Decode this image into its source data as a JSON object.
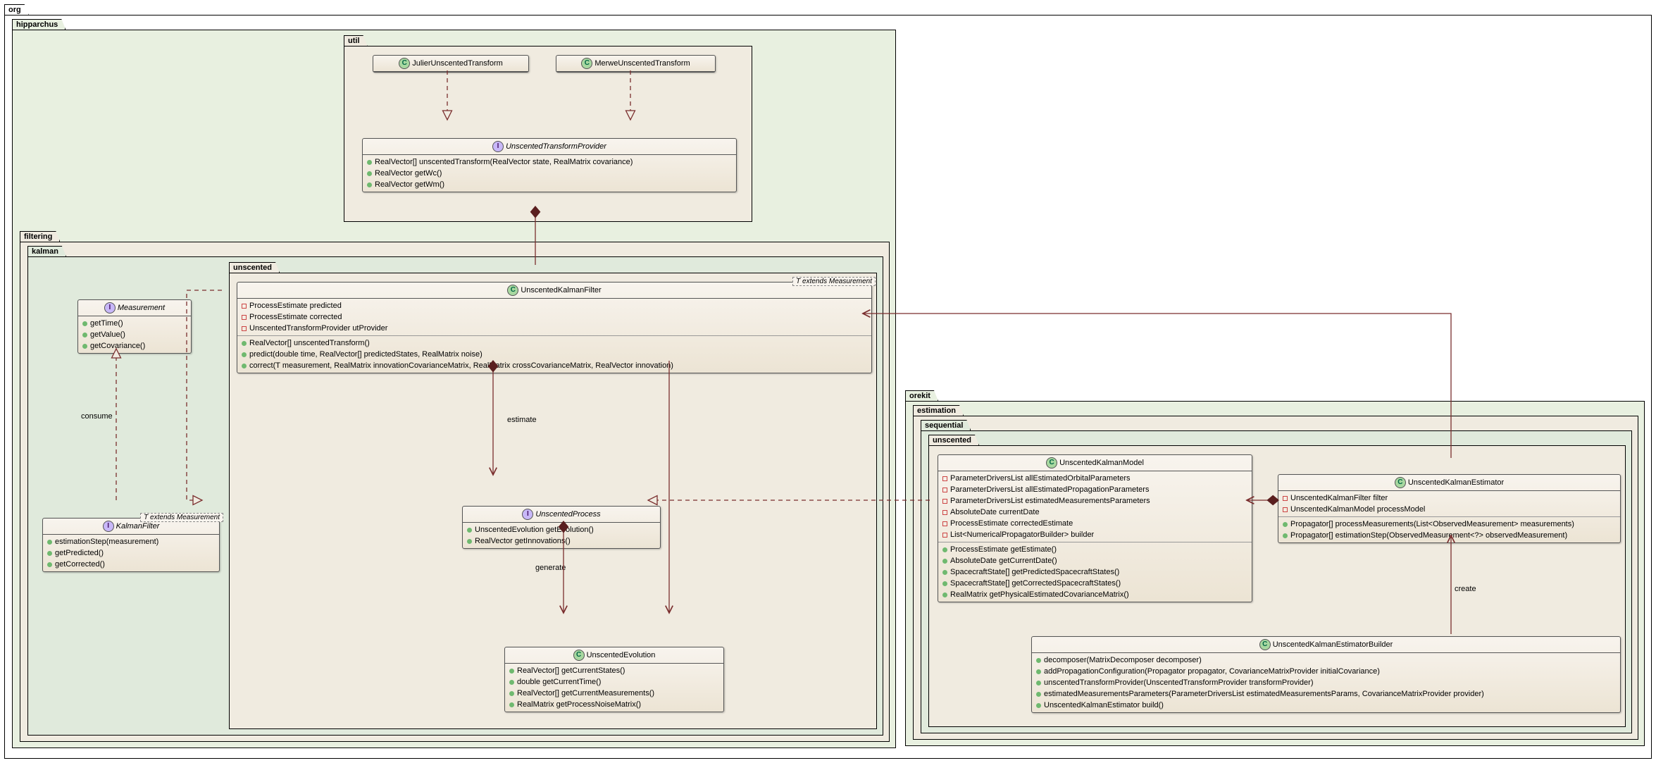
{
  "packages": {
    "org": "org",
    "hipparchus": "hipparchus",
    "util": "util",
    "filtering": "filtering",
    "kalman": "kalman",
    "unscented1": "unscented",
    "orekit": "orekit",
    "estimation": "estimation",
    "sequential": "sequential",
    "unscented2": "unscented"
  },
  "labels": {
    "consume": "consume",
    "estimate": "estimate",
    "generate": "generate",
    "create": "create",
    "t_ext": "T extends Measurement"
  },
  "classes": {
    "julier": {
      "name": "JulierUnscentedTransform",
      "type": "C"
    },
    "merwe": {
      "name": "MerweUnscentedTransform",
      "type": "C"
    },
    "utp": {
      "name": "UnscentedTransformProvider",
      "type": "I",
      "methods": [
        "RealVector[] unscentedTransform(RealVector state, RealMatrix covariance)",
        "RealVector getWc()",
        "RealVector getWm()"
      ]
    },
    "measurement": {
      "name": "Measurement",
      "type": "I",
      "methods": [
        "getTime()",
        "getValue()",
        "getCovariance()"
      ]
    },
    "kalmanfilter": {
      "name": "KalmanFilter",
      "type": "I",
      "template": "T extends Measurement",
      "methods": [
        "estimationStep(measurement)",
        "getPredicted()",
        "getCorrected()"
      ]
    },
    "ukf": {
      "name": "UnscentedKalmanFilter",
      "type": "C",
      "template": "T extends Measurement",
      "fields": [
        "ProcessEstimate predicted",
        "ProcessEstimate corrected",
        "UnscentedTransformProvider utProvider"
      ],
      "methods": [
        "RealVector[] unscentedTransform()",
        "predict(double time, RealVector[] predictedStates, RealMatrix noise)",
        "correct(T measurement, RealMatrix innovationCovarianceMatrix, RealMatrix crossCovarianceMatrix, RealVector innovation)"
      ]
    },
    "uprocess": {
      "name": "UnscentedProcess",
      "type": "I",
      "methods": [
        "UnscentedEvolution getEvolution()",
        "RealVector getInnovations()"
      ]
    },
    "uevolution": {
      "name": "UnscentedEvolution",
      "type": "C",
      "methods": [
        "RealVector[] getCurrentStates()",
        "double getCurrentTime()",
        "RealVector[] getCurrentMeasurements()",
        "RealMatrix getProcessNoiseMatrix()"
      ]
    },
    "ukmodel": {
      "name": "UnscentedKalmanModel",
      "type": "C",
      "fields": [
        "ParameterDriversList allEstimatedOrbitalParameters",
        "ParameterDriversList allEstimatedPropagationParameters",
        "ParameterDriversList estimatedMeasurementsParameters",
        "AbsoluteDate currentDate",
        "ProcessEstimate correctedEstimate",
        "List<NumericalPropagatorBuilder> builder"
      ],
      "methods": [
        "ProcessEstimate getEstimate()",
        "AbsoluteDate getCurrentDate()",
        "SpacecraftState[] getPredictedSpacecraftStates()",
        "SpacecraftState[] getCorrectedSpacecraftStates()",
        "RealMatrix getPhysicalEstimatedCovarianceMatrix()"
      ]
    },
    "ukestimator": {
      "name": "UnscentedKalmanEstimator",
      "type": "C",
      "fields": [
        "UnscentedKalmanFilter filter",
        "UnscentedKalmanModel processModel"
      ],
      "methods": [
        "Propagator[] processMeasurements(List<ObservedMeasurement> measurements)",
        "Propagator[] estimationStep(ObservedMeasurement<?> observedMeasurement)"
      ]
    },
    "ukbuilder": {
      "name": "UnscentedKalmanEstimatorBuilder",
      "type": "C",
      "methods": [
        "decomposer(MatrixDecomposer decomposer)",
        "addPropagationConfiguration(Propagator propagator, CovarianceMatrixProvider initialCovariance)",
        "unscentedTransformProvider(UnscentedTransformProvider transformProvider)",
        "estimatedMeasurementsParameters(ParameterDriversList estimatedMeasurementsParams, CovarianceMatrixProvider provider)",
        "UnscentedKalmanEstimator build()"
      ]
    }
  }
}
